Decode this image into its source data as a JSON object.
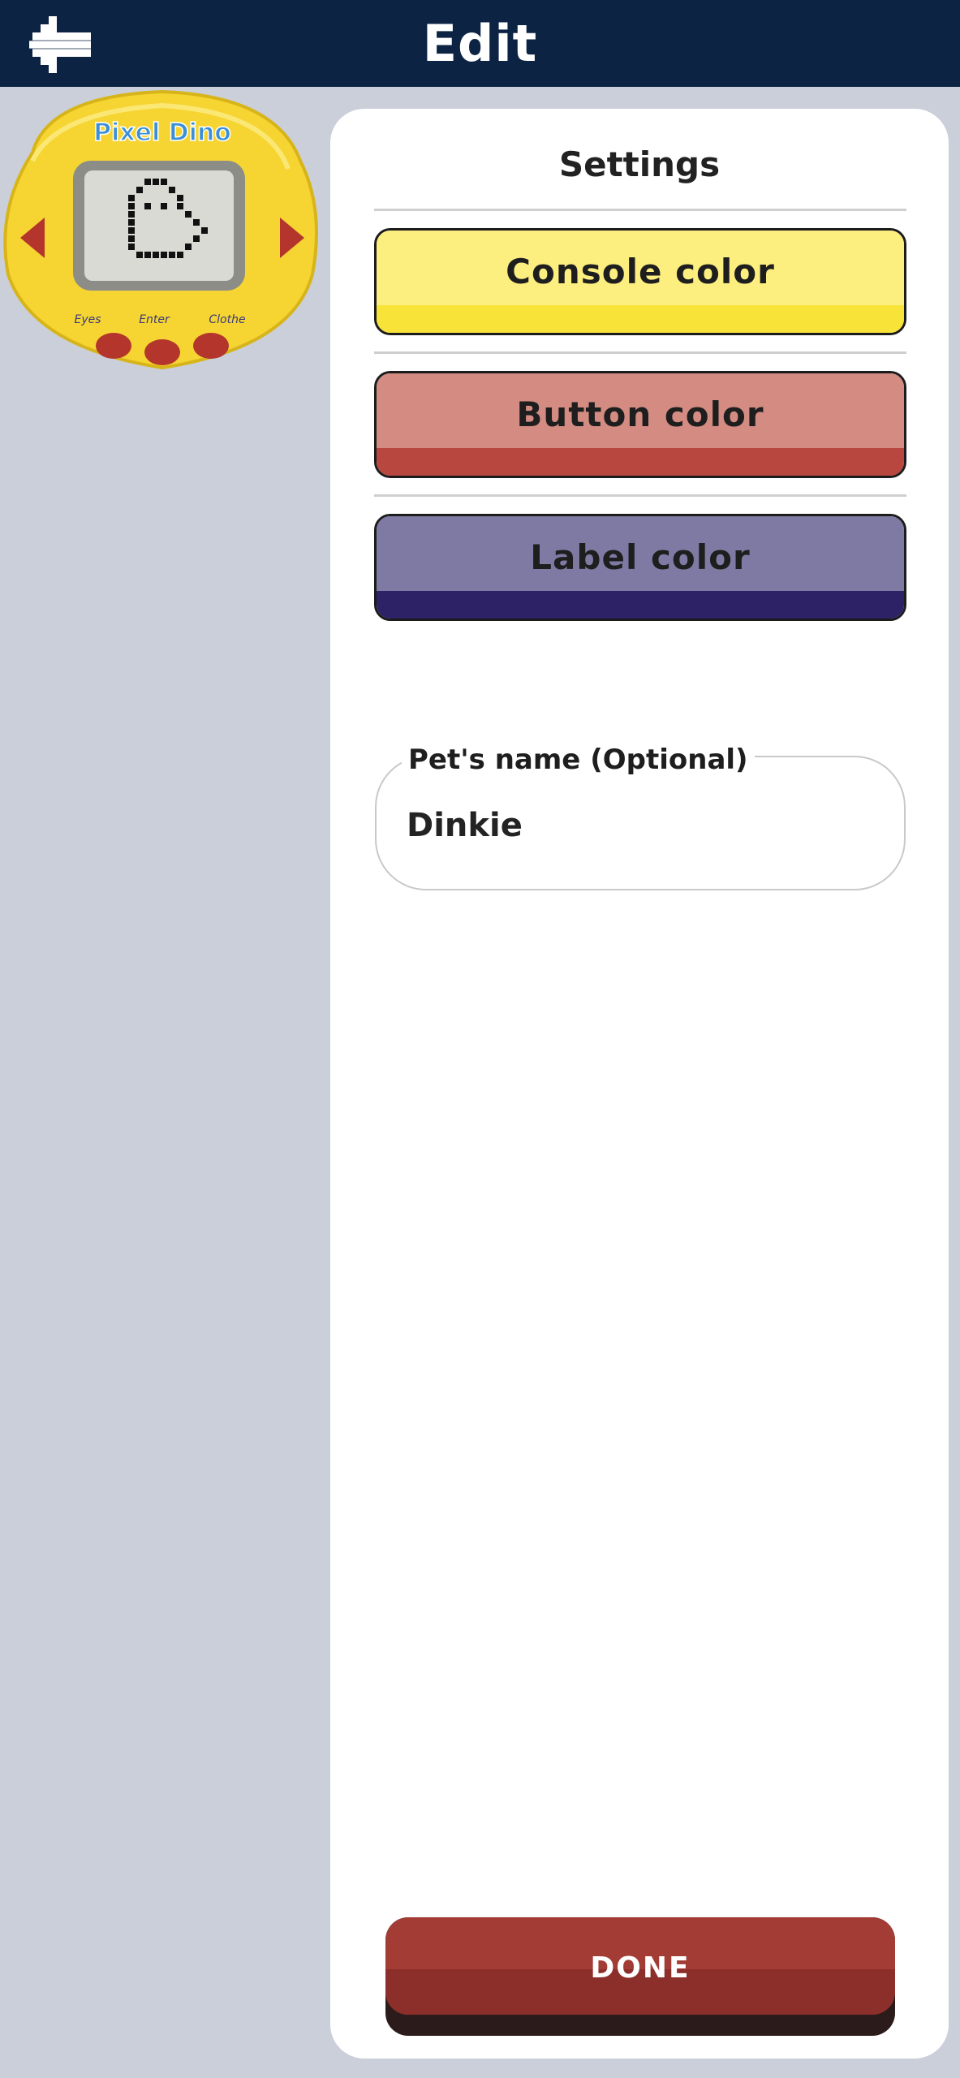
{
  "header": {
    "title": "Edit",
    "back_icon": "arrow-left-icon"
  },
  "device_preview": {
    "logo_text": "Pixel Dino",
    "bottom_labels": [
      "Eyes",
      "Enter",
      "Clothe"
    ],
    "body_color": "#f7d63a",
    "button_color": "#b4352c"
  },
  "settings": {
    "title": "Settings",
    "console_color": {
      "label": "Console color",
      "light": "#fdee80",
      "dark": "#f8e338"
    },
    "button_color": {
      "label": "Button color",
      "light": "#d38b82",
      "dark": "#b84740"
    },
    "label_color": {
      "label": "Label color",
      "light": "#7f7aa3",
      "dark": "#2d2266"
    },
    "pet_name": {
      "legend": "Pet's name (Optional)",
      "value": "Dinkie"
    },
    "done_label": "DONE"
  }
}
